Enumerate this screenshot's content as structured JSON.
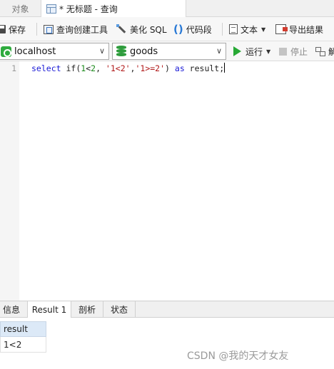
{
  "tabs": {
    "objects": "对象",
    "query": "* 无标题 - 查询"
  },
  "toolbar": {
    "save": "保存",
    "query_builder": "查询创建工具",
    "beautify_sql": "美化 SQL",
    "code_snippet": "代码段",
    "snippet_icon_glyph": "()",
    "text": "文本",
    "export_results": "导出结果"
  },
  "connection": {
    "server": "localhost",
    "database": "goods",
    "run": "运行",
    "stop": "停止",
    "explain": "解"
  },
  "editor": {
    "line_number": "1",
    "tokens": {
      "kw_select": "select",
      "fn_if": " if(",
      "num1": "1",
      "op_lt": "<",
      "num2": "2",
      "sep1": ", ",
      "str1": "'1<2'",
      "sep2": ",",
      "str2": "'1>=2'",
      "close": ") ",
      "kw_as": "as",
      "alias": " result;"
    }
  },
  "result_tabs": {
    "info": "信息",
    "result1": "Result 1",
    "profile": "剖析",
    "status": "状态"
  },
  "result_grid": {
    "columns": [
      "result"
    ],
    "rows": [
      [
        "1<2"
      ]
    ]
  },
  "watermark": "CSDN @我的天才女友",
  "colors": {
    "keyword": "#1a1ad6",
    "number": "#1b8a1b",
    "string": "#b01818",
    "run_green": "#27a935",
    "header_blue": "#dce9f7"
  }
}
